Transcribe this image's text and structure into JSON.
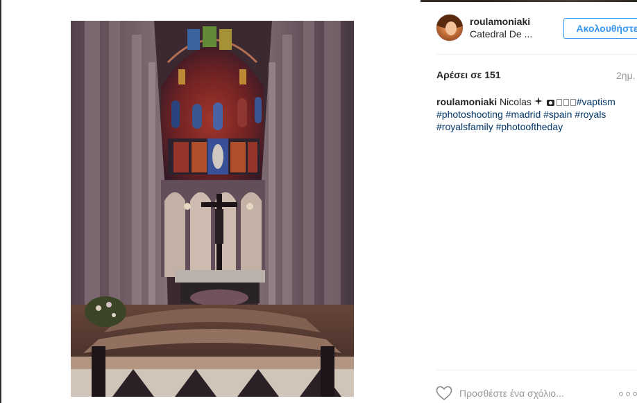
{
  "post": {
    "username": "roulamoniaki",
    "location": "Catedral De ...",
    "follow_label": "Ακολουθήστε",
    "likes_text": "Αρέσει σε 151",
    "time_ago": "2ημ.",
    "caption": {
      "user": "roulamoniaki",
      "text_start": "Nicolas",
      "tags": [
        "#vaptism",
        "#photoshooting",
        "#madrid",
        "#spain",
        "#royals",
        "#royalsfamily",
        "#photooftheday"
      ]
    },
    "comment_placeholder": "Προσθέστε ένα σχόλιο..."
  },
  "icons": {
    "sparkle": "sparkle-icon",
    "camera": "camera-icon",
    "heart": "heart-icon",
    "more": "more-options-icon"
  },
  "colors": {
    "accent": "#3897f0",
    "hashtag": "#003569",
    "muted": "#999999",
    "text": "#262626"
  }
}
